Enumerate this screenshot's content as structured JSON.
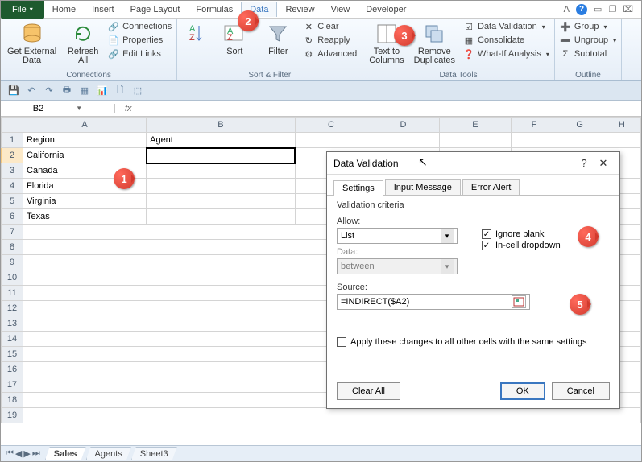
{
  "ribbon": {
    "file": "File",
    "tabs": [
      "Home",
      "Insert",
      "Page Layout",
      "Formulas",
      "Data",
      "Review",
      "View",
      "Developer"
    ],
    "active_tab": "Data",
    "groups": {
      "connections": {
        "label": "Connections",
        "get_external": "Get External\nData",
        "refresh": "Refresh\nAll",
        "items": [
          "Connections",
          "Properties",
          "Edit Links"
        ]
      },
      "sortfilter": {
        "label": "Sort & Filter",
        "sort": "Sort",
        "filter": "Filter",
        "clear": "Clear",
        "reapply": "Reapply",
        "advanced": "Advanced"
      },
      "datatools": {
        "label": "Data Tools",
        "ttc": "Text to\nColumns",
        "rdup": "Remove\nDuplicates",
        "dv": "Data Validation",
        "cons": "Consolidate",
        "whatif": "What-If Analysis"
      },
      "outline": {
        "label": "Outline",
        "group": "Group",
        "ungroup": "Ungroup",
        "subtotal": "Subtotal"
      }
    }
  },
  "namebox": "B2",
  "fx": "fx",
  "columns": [
    "A",
    "B",
    "C",
    "D",
    "E",
    "F",
    "G",
    "H"
  ],
  "rows": [
    1,
    2,
    3,
    4,
    5,
    6,
    7,
    8,
    9,
    10,
    11,
    12,
    13,
    14,
    15,
    16,
    17,
    18,
    19
  ],
  "cells": {
    "A1": "Region",
    "B1": "Agent",
    "A2": "California",
    "A3": "Canada",
    "A4": "Florida",
    "A5": "Virginia",
    "A6": "Texas"
  },
  "sheets": [
    "Sales",
    "Agents",
    "Sheet3"
  ],
  "active_sheet": "Sales",
  "dialog": {
    "title": "Data Validation",
    "tabs": [
      "Settings",
      "Input Message",
      "Error Alert"
    ],
    "active_tab": "Settings",
    "criteria_label": "Validation criteria",
    "allow_lbl": "Allow:",
    "allow_val": "List",
    "data_lbl": "Data:",
    "data_val": "between",
    "ignore_blank": "Ignore blank",
    "incell": "In-cell dropdown",
    "source_lbl": "Source:",
    "source_val": "=INDIRECT($A2)",
    "apply_all": "Apply these changes to all other cells with the same settings",
    "clear_all": "Clear All",
    "ok": "OK",
    "cancel": "Cancel"
  },
  "callouts": {
    "1": "1",
    "2": "2",
    "3": "3",
    "4": "4",
    "5": "5"
  }
}
